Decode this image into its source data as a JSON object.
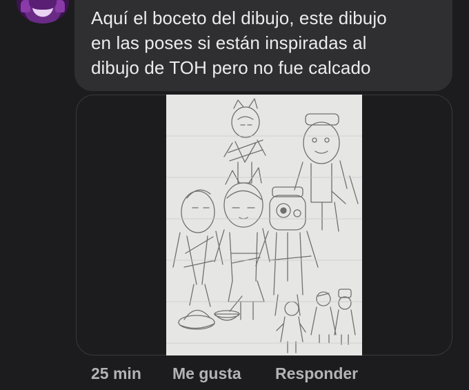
{
  "comment": {
    "text": "Aquí el boceto del dibujo, este dibujo\nen las poses si están inspiradas al\ndibujo de TOH pero no fue calcado"
  },
  "actions": {
    "time": "25 min",
    "like_label": "Me gusta",
    "reply_label": "Responder"
  },
  "colors": {
    "background": "#1c1c1e",
    "bubble": "#2f2f31",
    "text": "#ececec",
    "meta_text": "#b4b4b8",
    "paper": "#e6e6e4"
  },
  "icons": {
    "avatar": "user-avatar-icon"
  }
}
